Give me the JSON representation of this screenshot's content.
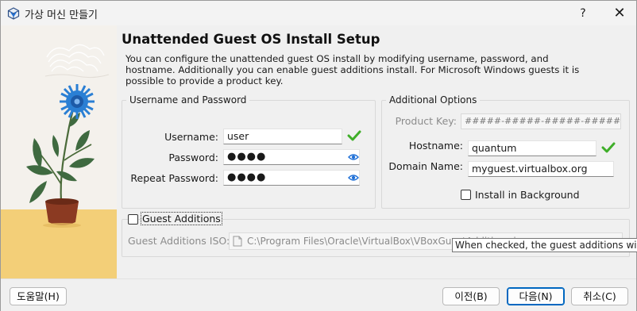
{
  "window": {
    "title": "가상 머신 만들기",
    "help_glyph": "?",
    "close_glyph": "✕"
  },
  "page": {
    "heading": "Unattended Guest OS Install Setup",
    "description_lines": [
      "You can configure the unattended guest OS install by modifying username, password, and",
      "hostname. Additionally you can enable guest additions install. For Microsoft Windows guests it is",
      "possible to provide a product key."
    ]
  },
  "credentials": {
    "group_title": "Username and Password",
    "username_label": "Username:",
    "username_value": "user",
    "password_label": "Password:",
    "password_value": "●●●●",
    "repeat_password_label": "Repeat Password:",
    "repeat_password_value": "●●●●"
  },
  "options": {
    "group_title": "Additional Options",
    "product_key_label": "Product Key:",
    "product_key_placeholder": "#####-#####-#####-#####-#####",
    "hostname_label": "Hostname:",
    "hostname_value": "quantum",
    "domain_label": "Domain Name:",
    "domain_value": "myguest.virtualbox.org",
    "install_background_label": "Install in Background",
    "install_background_checked": false
  },
  "guest_additions": {
    "checkbox_label": "Guest Additions",
    "checked": false,
    "iso_label": "Guest Additions ISO:",
    "iso_value": "C:\\Program Files\\Oracle\\VirtualBox\\VBoxGuestAdditions.iso",
    "tooltip": "When checked, the guest additions will be installed after the OS install."
  },
  "footer": {
    "help_button": "도움말(H)",
    "back_button": "이전(B)",
    "next_button": "다음(N)",
    "cancel_button": "취소(C)"
  },
  "colors": {
    "valid_check": "#3fae29",
    "primary_border": "#0067c0",
    "flower": "#2a7fd4",
    "pot": "#8b3a22",
    "floor": "#f3cf78"
  }
}
